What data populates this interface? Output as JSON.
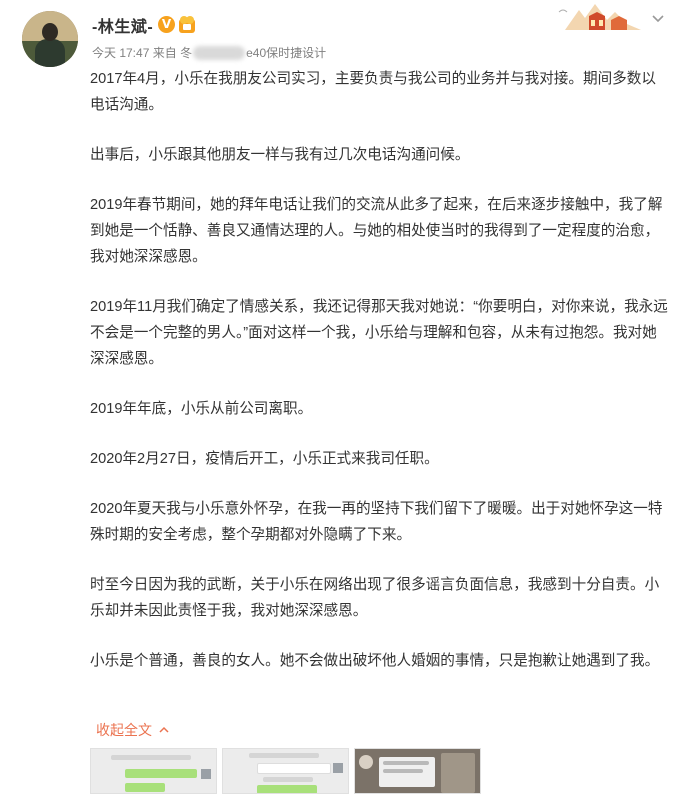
{
  "post": {
    "username": "-林生斌-",
    "vip_badge": "V",
    "time": "今天 17:47",
    "source_prefix": "来自",
    "source_visible_start": "冬",
    "source_visible_end": "e40保时捷设计"
  },
  "content": {
    "paragraphs": [
      "2017年4月，小乐在我朋友公司实习，主要负责与我公司的业务并与我对接。期间多数以电话沟通。",
      "出事后，小乐跟其他朋友一样与我有过几次电话沟通问候。",
      "2019年春节期间，她的拜年电话让我们的交流从此多了起来，在后来逐步接触中，我了解到她是一个恬静、善良又通情达理的人。与她的相处使当时的我得到了一定程度的治愈，我对她深深感恩。",
      "2019年11月我们确定了情感关系，我还记得那天我对她说：“你要明白，对你来说，我永远不会是一个完整的男人。”面对这样一个我，小乐给与理解和包容，从未有过抱怨。我对她深深感恩。",
      "2019年年底，小乐从前公司离职。",
      "2020年2月27日，疫情后开工，小乐正式来我司任职。",
      "2020年夏天我与小乐意外怀孕，在我一再的坚持下我们留下了暖暖。出于对她怀孕这一特殊时期的安全考虑，整个孕期都对外隐瞒了下来。",
      "时至今日因为我的武断，关于小乐在网络出现了很多谣言负面信息，我感到十分自责。小乐却并未因此责怪于我，我对她深深感恩。",
      "小乐是个普通，善良的女人。她不会做出破坏他人婚姻的事情，只是抱歉让她遇到了我。"
    ],
    "collapse_label": "收起全文"
  },
  "colors": {
    "link": "#eb7350",
    "meta": "#808080",
    "text": "#333333",
    "vip": "#f7a21e"
  },
  "icons": {
    "vip": "vip-v-badge-icon",
    "level": "level-badge-icon",
    "dropdown": "chevron-down-icon",
    "collapse": "chevron-up-icon"
  }
}
